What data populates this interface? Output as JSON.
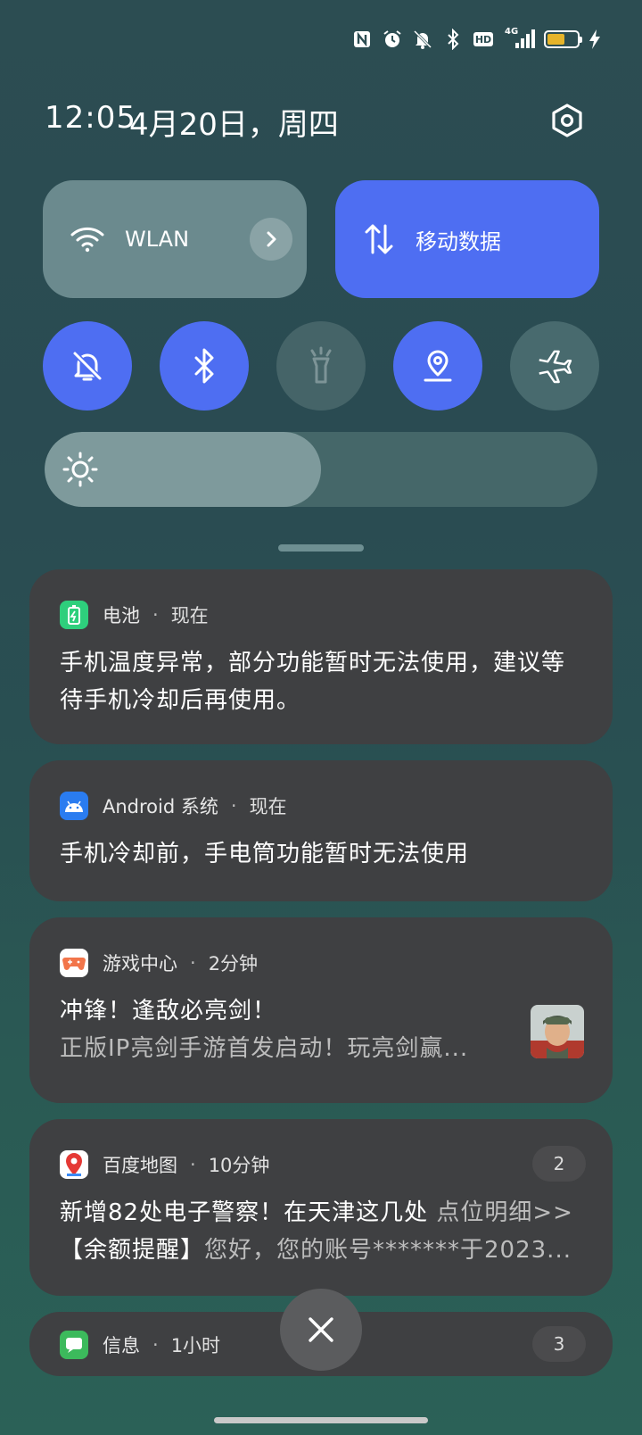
{
  "status_bar": {
    "icons": [
      "nfc-icon",
      "alarm-icon",
      "mute-icon",
      "bluetooth-icon",
      "hd-icon",
      "signal-4g-icon",
      "battery-icon",
      "charging-icon"
    ],
    "hd_label": "HD",
    "network_label": "4G",
    "battery_level": 0.6,
    "battery_color": "#e6b42a"
  },
  "header": {
    "time": "12:05",
    "date": "4月20日，周四"
  },
  "tiles": {
    "wlan_label": "WLAN",
    "mobile_data_label": "移动数据"
  },
  "toggles": [
    {
      "name": "mute",
      "state": "on"
    },
    {
      "name": "bluetooth",
      "state": "on"
    },
    {
      "name": "flashlight",
      "state": "disabled"
    },
    {
      "name": "location",
      "state": "on"
    },
    {
      "name": "airplane",
      "state": "off"
    }
  ],
  "brightness": {
    "level": 0.5
  },
  "colors": {
    "accent": "#4e6ef2",
    "card": "#3f4042"
  },
  "notifications": [
    {
      "app": "电池",
      "time": "现在",
      "icon": "battery-app-icon",
      "title": "手机温度异常，部分功能暂时无法使用，建议等",
      "title2": "待手机冷却后再使用。"
    },
    {
      "app": "Android 系统",
      "time": "现在",
      "icon": "android-icon",
      "title": "手机冷却前，手电筒功能暂时无法使用"
    },
    {
      "app": "游戏中心",
      "time": "2分钟",
      "icon": "game-center-icon",
      "title": "冲锋！逢敌必亮剑！",
      "subtitle": "正版IP亮剑手游首发启动！玩亮剑赢..."
    },
    {
      "app": "百度地图",
      "time": "10分钟",
      "icon": "baidu-map-icon",
      "count": "2",
      "title": "新增82处电子警察！在天津这几处",
      "title_link": "点位明细>>",
      "subtitle_head": "【余额提醒】",
      "subtitle": "您好，您的账号*******于2023..."
    },
    {
      "app": "信息",
      "time": "1小时",
      "icon": "messages-icon",
      "count": "3"
    }
  ]
}
